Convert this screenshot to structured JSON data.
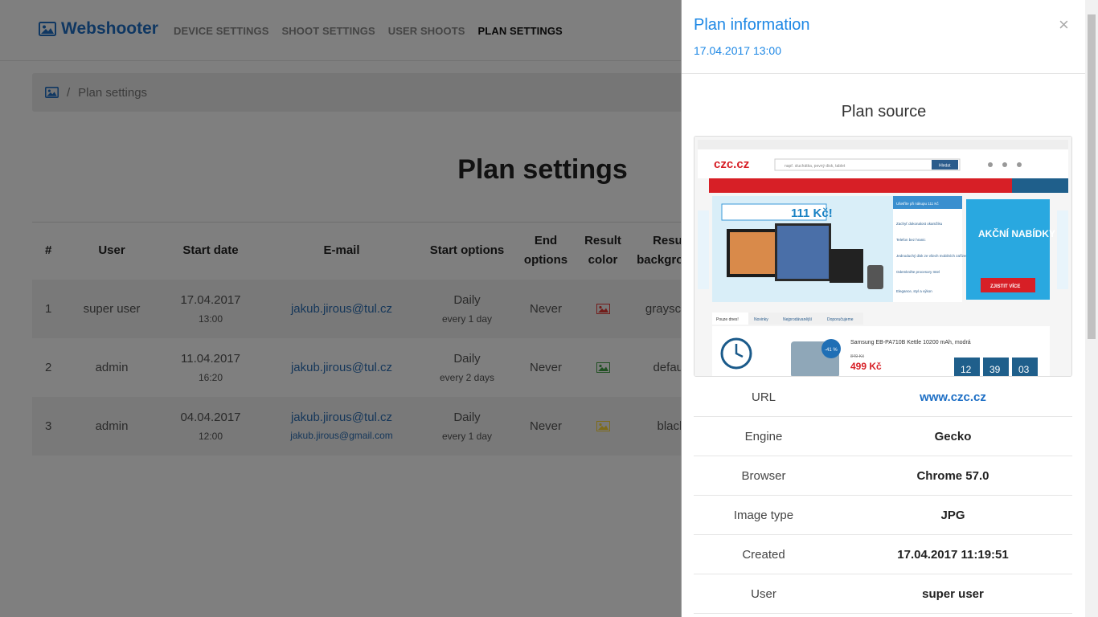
{
  "nav": {
    "brand": "Webshooter",
    "links": [
      "DEVICE SETTINGS",
      "SHOOT SETTINGS",
      "USER SHOOTS",
      "PLAN SETTINGS"
    ],
    "active_index": 3
  },
  "breadcrumb": {
    "separator": "/",
    "current": "Plan settings"
  },
  "page_title": "Plan settings",
  "table": {
    "headers": {
      "num": "#",
      "user": "User",
      "start_date": "Start date",
      "email": "E-mail",
      "start_options": "Start options",
      "end_options": "End options",
      "result_color": "Result color",
      "result_background": "Result background"
    },
    "rows": [
      {
        "num": "1",
        "user": "super user",
        "date": "17.04.2017",
        "time": "13:00",
        "email": "jakub.jirous@tul.cz",
        "email2": "",
        "start": "Daily",
        "every": "every 1 day",
        "end": "Never",
        "color_icon": "image-icon",
        "color": "#e53935",
        "background": "grayscale"
      },
      {
        "num": "2",
        "user": "admin",
        "date": "11.04.2017",
        "time": "16:20",
        "email": "jakub.jirous@tul.cz",
        "email2": "",
        "start": "Daily",
        "every": "every 2 days",
        "end": "Never",
        "color_icon": "image-icon",
        "color": "#43a047",
        "background": "default"
      },
      {
        "num": "3",
        "user": "admin",
        "date": "04.04.2017",
        "time": "12:00",
        "email": "jakub.jirous@tul.cz",
        "email2": "jakub.jirous@gmail.com",
        "start": "Daily",
        "every": "every 1 day",
        "end": "Never",
        "color_icon": "image-icon",
        "color": "#fdd835",
        "background": "black"
      }
    ]
  },
  "modal": {
    "title": "Plan information",
    "subtitle": "17.04.2017 13:00",
    "close": "×",
    "source_title": "Plan source",
    "details": [
      {
        "label": "URL",
        "value": "www.czc.cz",
        "link": true
      },
      {
        "label": "Engine",
        "value": "Gecko"
      },
      {
        "label": "Browser",
        "value": "Chrome 57.0"
      },
      {
        "label": "Image type",
        "value": "JPG"
      },
      {
        "label": "Created",
        "value": "17.04.2017 11:19:51"
      },
      {
        "label": "User",
        "value": "super user"
      }
    ]
  },
  "screenshot": {
    "logo": "czc.cz",
    "search_placeholder": "např. sluchátka, pevný disk, tablet",
    "search_button": "Hledat",
    "promo_price": "111 Kč!",
    "offer_title": "AKČNÍ NABÍDKY",
    "offer_button": "ZJISTIT VÍCE",
    "tabs": [
      "Pouze dnes!",
      "Novinky",
      "Nejprodávanější",
      "Doporučujeme"
    ],
    "product_name": "Samsung EB-PA710B Kettle 10200 mAh, modrá",
    "old_price": "849 Kč",
    "new_price": "499 Kč",
    "discount": "-41 %",
    "countdown": [
      "12",
      "39",
      "03"
    ],
    "menu_items": [
      "Ušetříte při nákupu 111 Kč",
      "Zachyť dokonalost okamžiku",
      "Telefon bez hranic",
      "Jednoduchý disk ze všech mobilních zařízení",
      "Odemkněte procesory Intel",
      "Elegance, styl a výkon"
    ]
  },
  "colors": {
    "accent": "#1e88e5",
    "brand": "#1f6fc5",
    "link": "#2c6fb5"
  }
}
